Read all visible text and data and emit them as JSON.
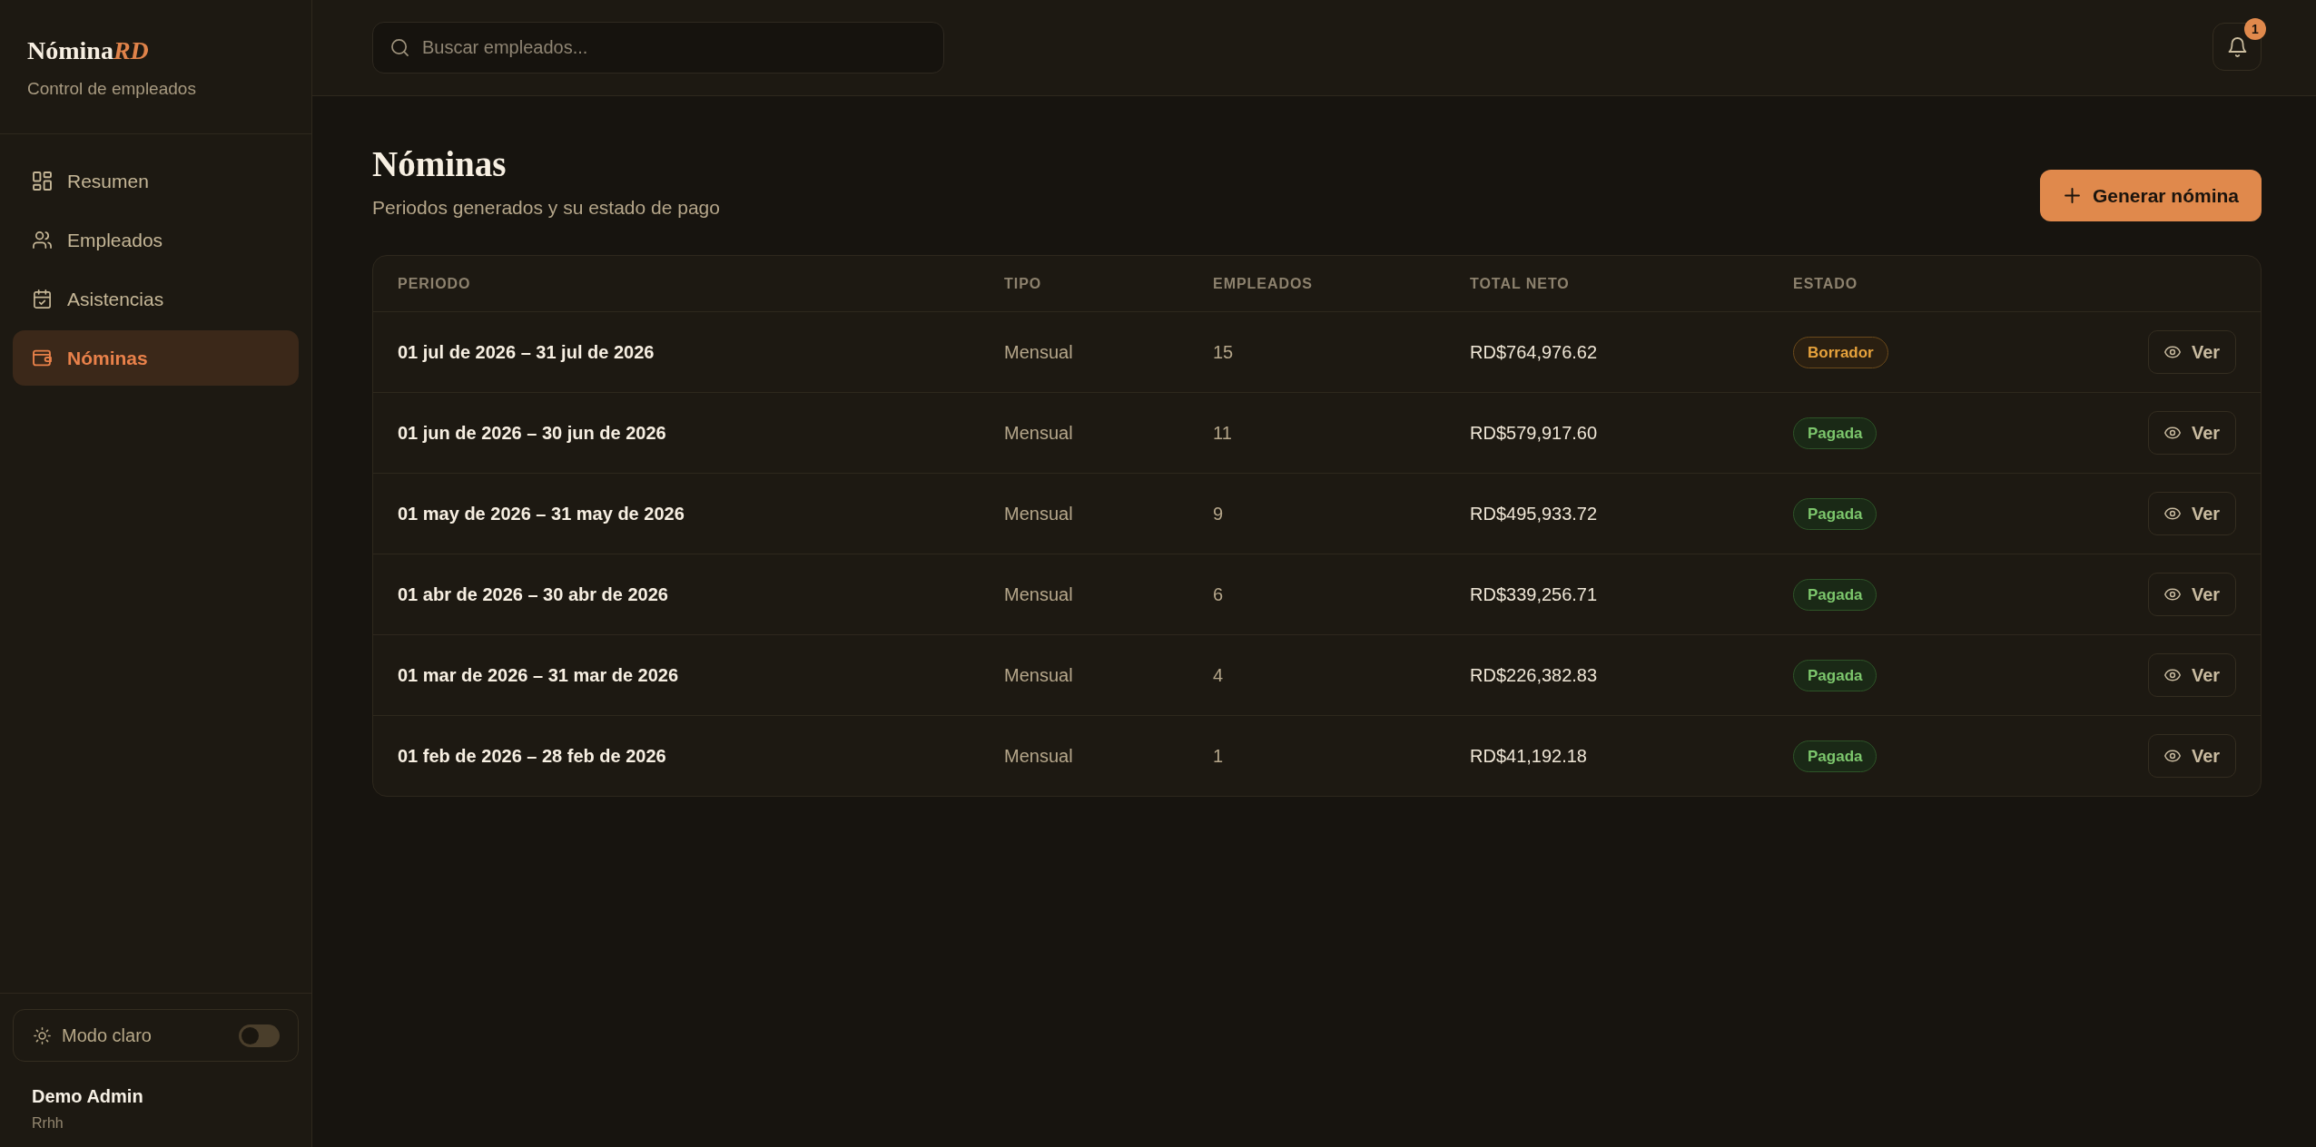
{
  "sidebar": {
    "logo": {
      "name": "Nómina",
      "accent": "RD"
    },
    "subtitle": "Control de empleados",
    "nav": [
      {
        "label": "Resumen",
        "selected": false
      },
      {
        "label": "Empleados",
        "selected": false
      },
      {
        "label": "Asistencias",
        "selected": false
      },
      {
        "label": "Nóminas",
        "selected": true
      }
    ],
    "theme_toggle": {
      "label": "Modo claro",
      "on": false
    },
    "user": {
      "name": "Demo Admin",
      "role": "Rrhh"
    }
  },
  "topbar": {
    "search": {
      "placeholder": "Buscar empleados..."
    },
    "notifications": {
      "count": "1"
    }
  },
  "page": {
    "title": "Nóminas",
    "subtitle": "Periodos generados y su estado de pago",
    "primary_button": "Generar nómina"
  },
  "table": {
    "columns": [
      "PERIODO",
      "TIPO",
      "EMPLEADOS",
      "TOTAL NETO",
      "ESTADO"
    ],
    "rows": [
      {
        "period": "01 jul de 2026 – 31 jul de 2026",
        "type": "Mensual",
        "employees": "15",
        "net_total": "RD$764,976.62",
        "status": {
          "label": "Borrador",
          "kind": "draft"
        },
        "action": "Ver"
      },
      {
        "period": "01 jun de 2026 – 30 jun de 2026",
        "type": "Mensual",
        "employees": "11",
        "net_total": "RD$579,917.60",
        "status": {
          "label": "Pagada",
          "kind": "paid"
        },
        "action": "Ver"
      },
      {
        "period": "01 may de 2026 – 31 may de 2026",
        "type": "Mensual",
        "employees": "9",
        "net_total": "RD$495,933.72",
        "status": {
          "label": "Pagada",
          "kind": "paid"
        },
        "action": "Ver"
      },
      {
        "period": "01 abr de 2026 – 30 abr de 2026",
        "type": "Mensual",
        "employees": "6",
        "net_total": "RD$339,256.71",
        "status": {
          "label": "Pagada",
          "kind": "paid"
        },
        "action": "Ver"
      },
      {
        "period": "01 mar de 2026 – 31 mar de 2026",
        "type": "Mensual",
        "employees": "4",
        "net_total": "RD$226,382.83",
        "status": {
          "label": "Pagada",
          "kind": "paid"
        },
        "action": "Ver"
      },
      {
        "period": "01 feb de 2026 – 28 feb de 2026",
        "type": "Mensual",
        "employees": "1",
        "net_total": "RD$41,192.18",
        "status": {
          "label": "Pagada",
          "kind": "paid"
        },
        "action": "Ver"
      }
    ]
  }
}
